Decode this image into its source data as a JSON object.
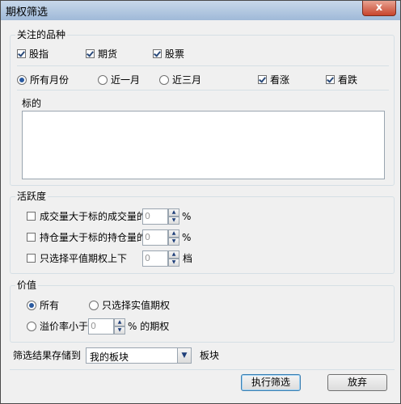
{
  "window": {
    "title": "期权筛选",
    "close_glyph": "x"
  },
  "varieties": {
    "legend": "关注的品种",
    "types": [
      {
        "label": "股指",
        "checked": true
      },
      {
        "label": "期货",
        "checked": true
      },
      {
        "label": "股票",
        "checked": true
      }
    ],
    "months": [
      {
        "label": "所有月份",
        "selected": true
      },
      {
        "label": "近一月",
        "selected": false
      },
      {
        "label": "近三月",
        "selected": false
      }
    ],
    "bull": {
      "label": "看涨",
      "checked": true
    },
    "bear": {
      "label": "看跌",
      "checked": true
    },
    "underlying_label": "标的",
    "underlying_value": ""
  },
  "activity": {
    "legend": "活跃度",
    "rows": [
      {
        "label": "成交量大于标的成交量的",
        "checked": false,
        "value": "0",
        "unit": "%"
      },
      {
        "label": "持仓量大于标的持仓量的",
        "checked": false,
        "value": "0",
        "unit": "%"
      },
      {
        "label": "只选择平值期权上下",
        "checked": false,
        "value": "0",
        "unit": "档"
      }
    ]
  },
  "value": {
    "legend": "价值",
    "all": {
      "label": "所有",
      "selected": true
    },
    "real": {
      "label": "只选择实值期权",
      "selected": false
    },
    "premium": {
      "label": "溢价率小于",
      "selected": false,
      "value": "0",
      "suffix": "% 的期权"
    }
  },
  "save": {
    "label": "筛选结果存储到",
    "selected": "我的板块",
    "suffix": "板块"
  },
  "buttons": {
    "execute": "执行筛选",
    "cancel": "放弃"
  }
}
